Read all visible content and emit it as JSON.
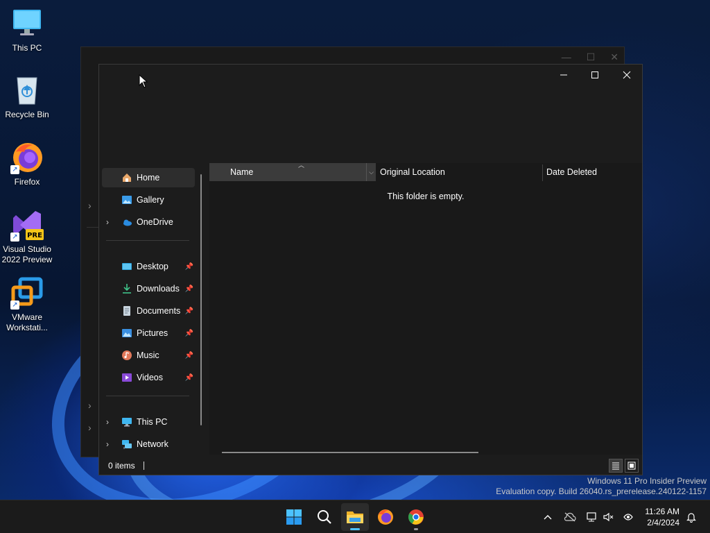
{
  "desktop": {
    "icons": [
      {
        "label": "This PC",
        "icon": "monitor-icon"
      },
      {
        "label": "Recycle Bin",
        "icon": "recycle-bin-icon"
      },
      {
        "label": "Firefox",
        "icon": "firefox-icon"
      },
      {
        "label": "Visual Studio 2022 Preview",
        "icon": "visual-studio-icon",
        "badge": "PRE"
      },
      {
        "label": "VMware Workstati...",
        "icon": "vmware-icon"
      }
    ]
  },
  "explorer": {
    "nav": {
      "home": "Home",
      "gallery": "Gallery",
      "onedrive": "OneDrive",
      "desktop": "Desktop",
      "downloads": "Downloads",
      "documents": "Documents",
      "pictures": "Pictures",
      "music": "Music",
      "videos": "Videos",
      "thispc": "This PC",
      "network": "Network"
    },
    "columns": {
      "name": "Name",
      "original_location": "Original Location",
      "date_deleted": "Date Deleted"
    },
    "empty_message": "This folder is empty.",
    "status": {
      "item_count": "0 items"
    }
  },
  "watermark": {
    "line1": "Windows 11 Pro Insider Preview",
    "line2": "Evaluation copy. Build 26040.rs_prerelease.240122-1157"
  },
  "taskbar": {
    "apps": [
      "start-icon",
      "search-icon",
      "file-explorer-icon",
      "firefox-icon",
      "chrome-icon"
    ],
    "clock": {
      "time": "11:26 AM",
      "date": "2/4/2024"
    }
  },
  "colors": {
    "accent": "#4cc2ff",
    "window_bg": "#1c1c1c",
    "taskbar_bg": "#1b1b1b"
  }
}
